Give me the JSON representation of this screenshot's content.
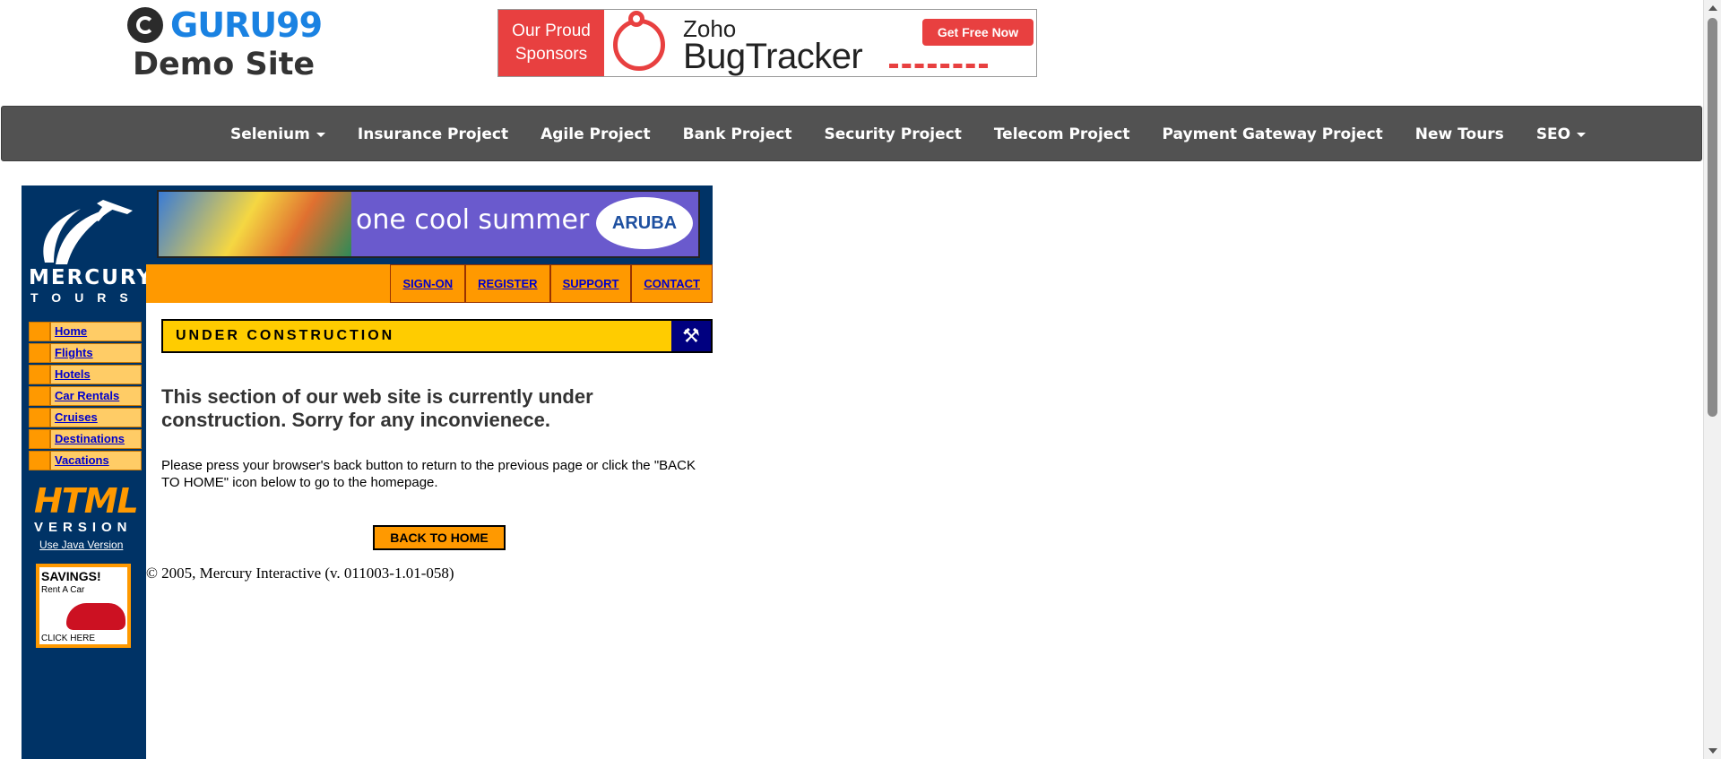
{
  "header": {
    "logo_text": "GURU99",
    "logo_subtitle": "Demo Site",
    "sponsor": {
      "label_line1": "Our Proud",
      "label_line2": "Sponsors",
      "brand_small": "Zoho",
      "brand_large": "BugTracker",
      "cta": "Get Free Now"
    }
  },
  "navbar": {
    "items": [
      {
        "label": "Selenium",
        "dropdown": true
      },
      {
        "label": "Insurance Project"
      },
      {
        "label": "Agile Project"
      },
      {
        "label": "Bank Project"
      },
      {
        "label": "Security Project"
      },
      {
        "label": "Telecom Project"
      },
      {
        "label": "Payment Gateway Project"
      },
      {
        "label": "New Tours"
      },
      {
        "label": "SEO",
        "dropdown": true
      }
    ]
  },
  "mercury": {
    "logo_word": "MERCURY",
    "logo_sub": "TOURS",
    "banner_text": "one cool summer",
    "banner_brand": "ARUBA",
    "top_links": [
      "SIGN-ON",
      "REGISTER",
      "SUPPORT",
      "CONTACT"
    ],
    "side_links": [
      "Home",
      "Flights",
      "Hotels",
      "Car Rentals",
      "Cruises",
      "Destinations",
      "Vacations"
    ],
    "html_version_title": "HTML",
    "html_version_sub": "VERSION",
    "java_link": "Use Java Version",
    "savings_title": "SAVINGS!",
    "savings_sub": "Rent A Car",
    "savings_cta": "CLICK HERE",
    "under_construction": "UNDER CONSTRUCTION",
    "heading": "This section of our web site is currently under construction.   Sorry for any inconvienece.",
    "paragraph": "Please press your browser's back button to return to the previous page or click the \"BACK TO HOME\" icon below to go to the homepage.",
    "back_button": "BACK TO HOME",
    "copyright": "© 2005, Mercury Interactive (v. 011003-1.01-058)"
  },
  "colors": {
    "navbar_bg": "#525252",
    "mercury_navy": "#003366",
    "mercury_orange": "#ff9900",
    "guru_blue": "#1a82e2",
    "sponsor_red": "#e84040"
  }
}
